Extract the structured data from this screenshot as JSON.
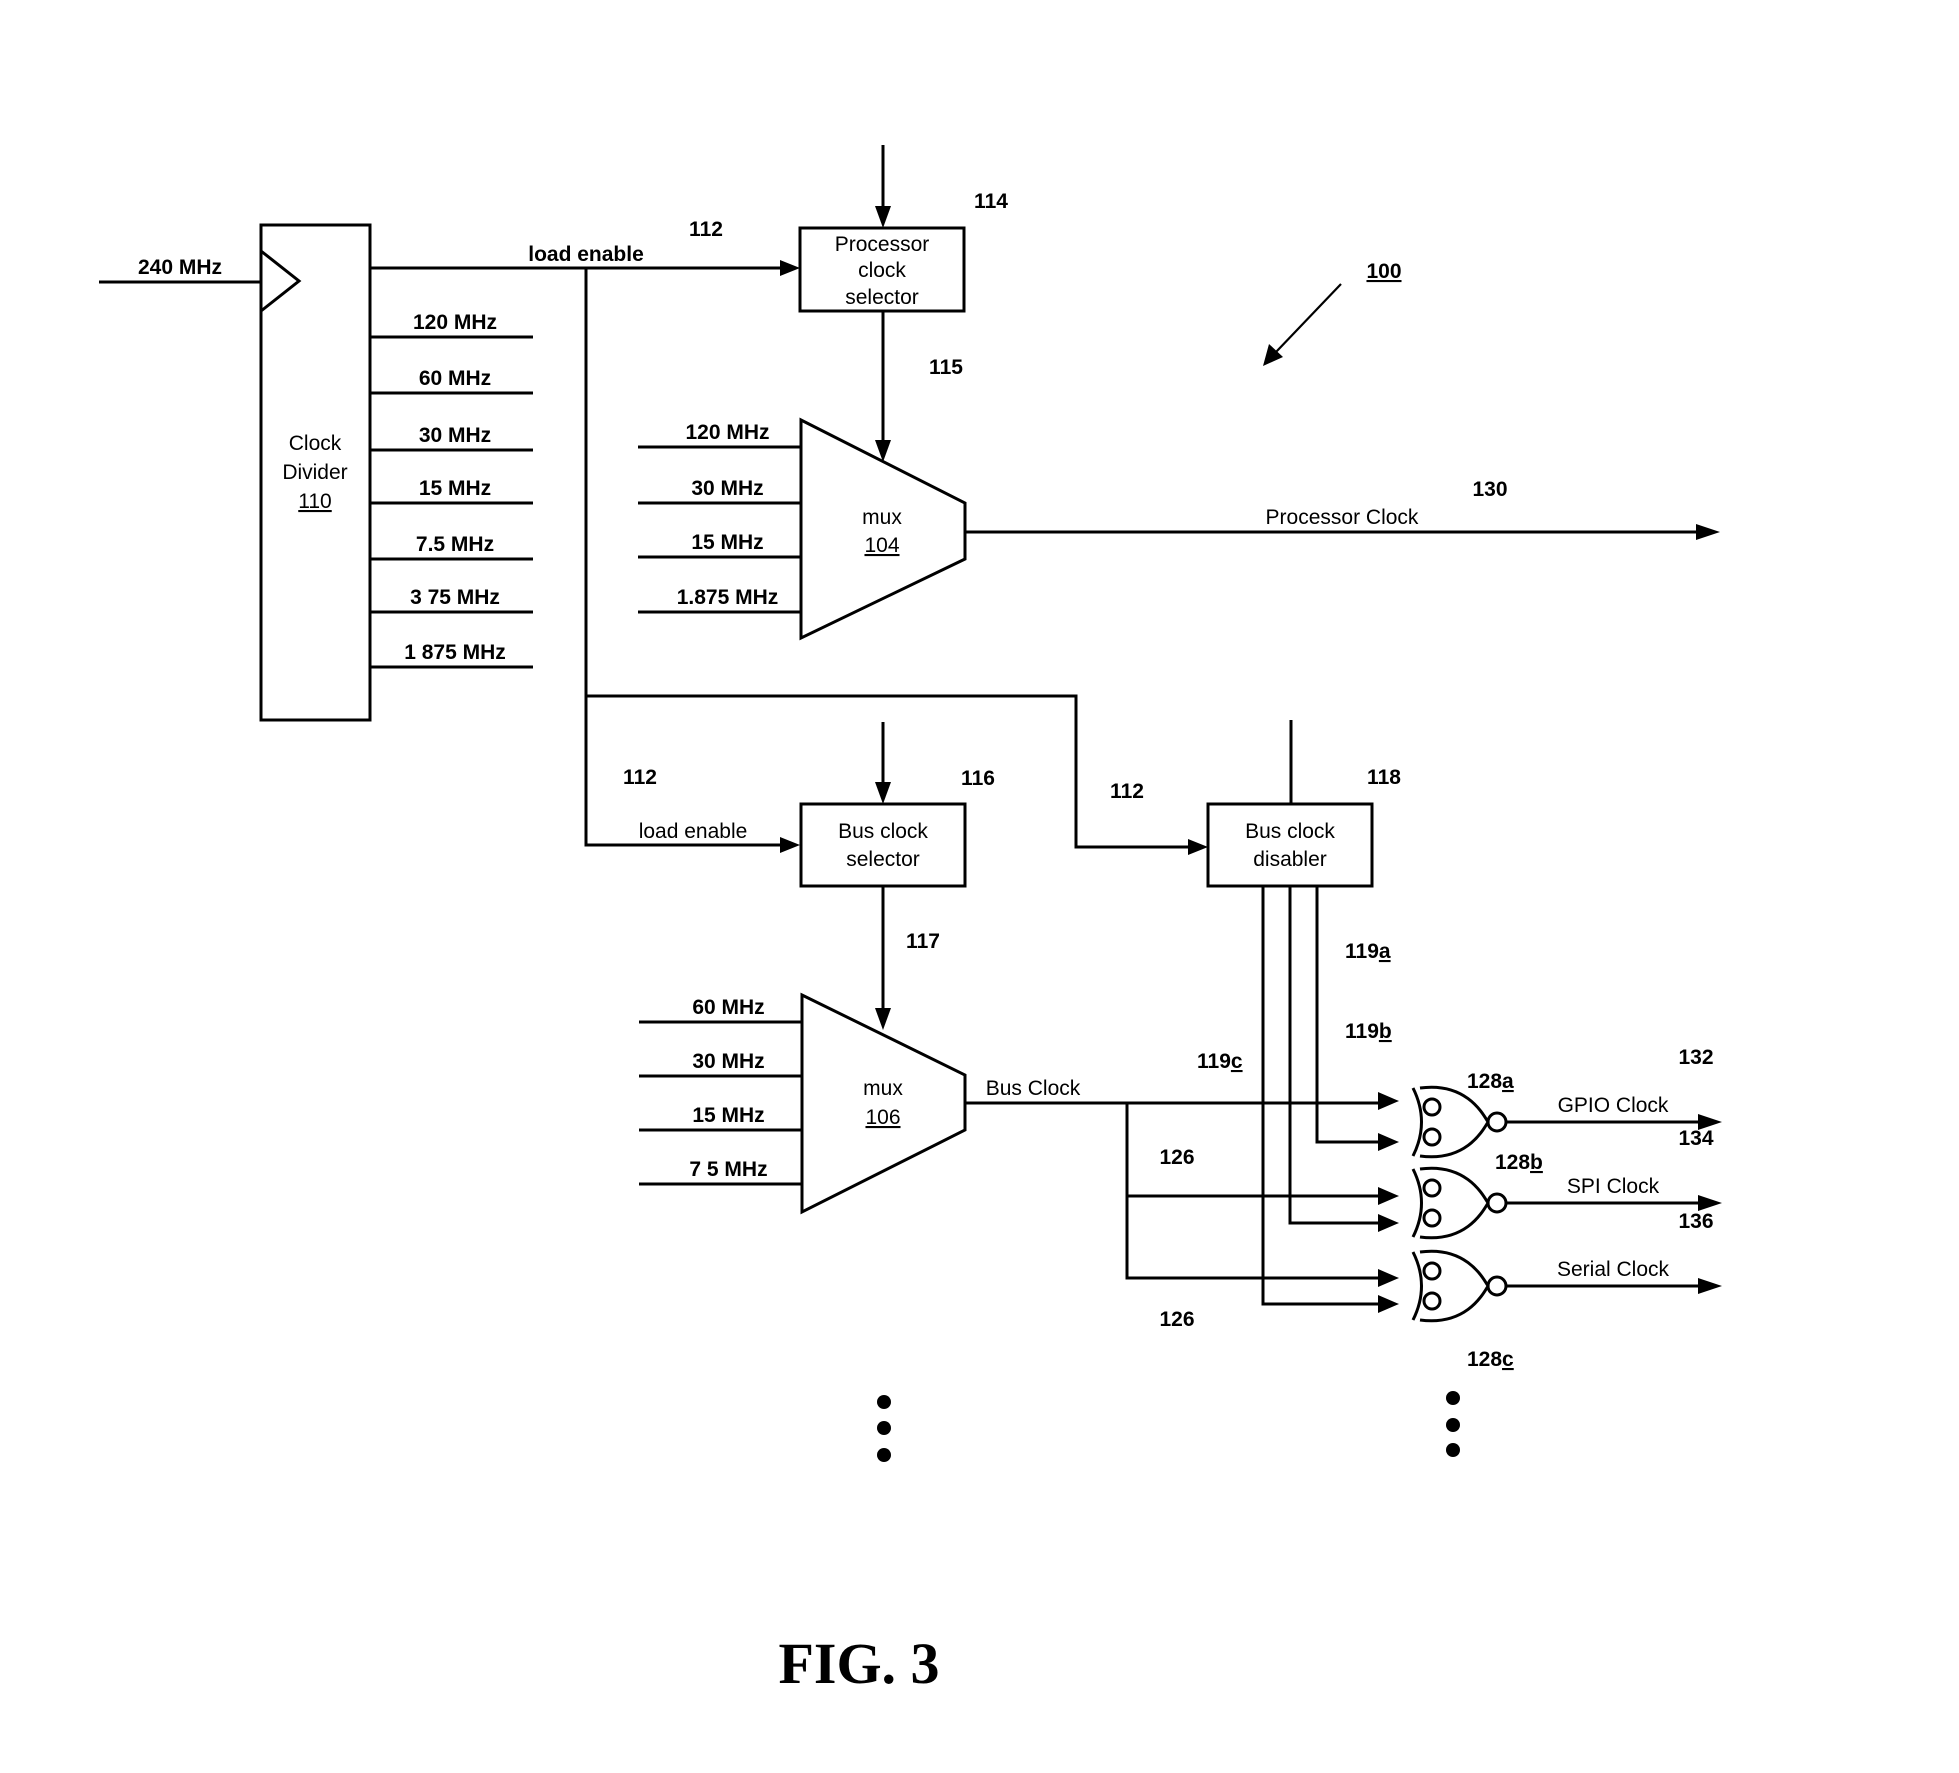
{
  "figure": {
    "caption": "FIG. 3",
    "system_ref": "100"
  },
  "clock_divider": {
    "title_line1": "Clock",
    "title_line2": "Divider",
    "ref": "110",
    "input_label": "240 MHz",
    "outputs": [
      "120 MHz",
      "60 MHz",
      "30 MHz",
      "15 MHz",
      "7.5 MHz",
      "3 75 MHz",
      "1 875 MHz"
    ]
  },
  "load_enable": {
    "label": "load enable",
    "ref": "112"
  },
  "processor_clock_selector": {
    "line1": "Processor",
    "line2": "clock",
    "line3": "selector",
    "ref": "114",
    "select_ref": "115"
  },
  "mux_104": {
    "label": "mux",
    "ref": "104",
    "inputs": [
      "120 MHz",
      "30 MHz",
      "15 MHz",
      "1.875 MHz"
    ],
    "output_label": "Processor Clock",
    "output_ref": "130"
  },
  "bus_clock_selector": {
    "line1": "Bus clock",
    "line2": "selector",
    "ref": "116",
    "load_label": "load enable",
    "load_ref": "112",
    "select_ref": "117"
  },
  "bus_clock_disabler": {
    "line1": "Bus clock",
    "line2": "disabler",
    "ref": "118",
    "load_ref": "112",
    "enable_lines": [
      {
        "num": "119",
        "suffix": "a"
      },
      {
        "num": "119",
        "suffix": "b"
      },
      {
        "num": "119",
        "suffix": "c"
      }
    ]
  },
  "mux_106": {
    "label": "mux",
    "ref": "106",
    "inputs": [
      "60 MHz",
      "30 MHz",
      "15 MHz",
      "7 5 MHz"
    ],
    "output_label": "Bus Clock",
    "branch_ref_upper": "126",
    "branch_ref_lower": "126"
  },
  "gates": [
    {
      "num": "128",
      "suffix": "a",
      "output_label": "GPIO Clock",
      "output_ref": "132"
    },
    {
      "num": "128",
      "suffix": "b",
      "output_label": "SPI Clock",
      "output_ref": "134"
    },
    {
      "num": "128",
      "suffix": "c",
      "output_label": "Serial Clock",
      "output_ref": "136"
    }
  ]
}
